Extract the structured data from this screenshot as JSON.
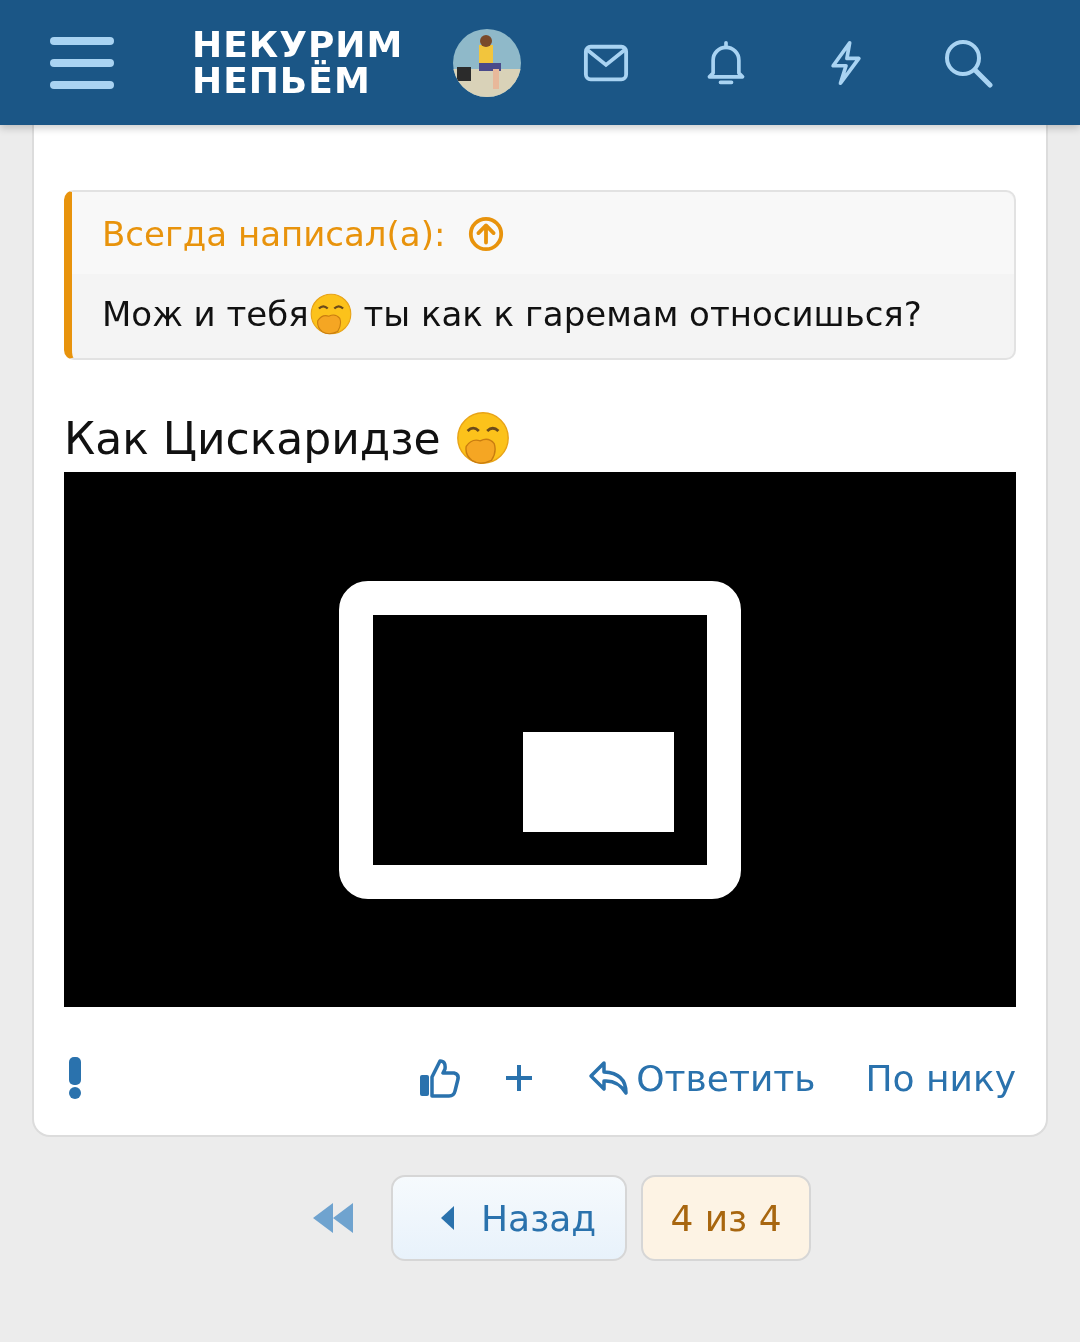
{
  "header": {
    "logo_lines": [
      "НЕКУРИМ",
      "НЕПЬЁМ"
    ]
  },
  "post": {
    "quote": {
      "author": "Всегда написал(а):",
      "text_before": "Мож и тебя",
      "text_after": " ты как к гаремам относишься?"
    },
    "body": "Как Цискаридзе ",
    "actions": {
      "reply": "Ответить",
      "by_nick": "По нику"
    }
  },
  "pagination": {
    "back": "Назад",
    "current": "4 из 4"
  }
}
